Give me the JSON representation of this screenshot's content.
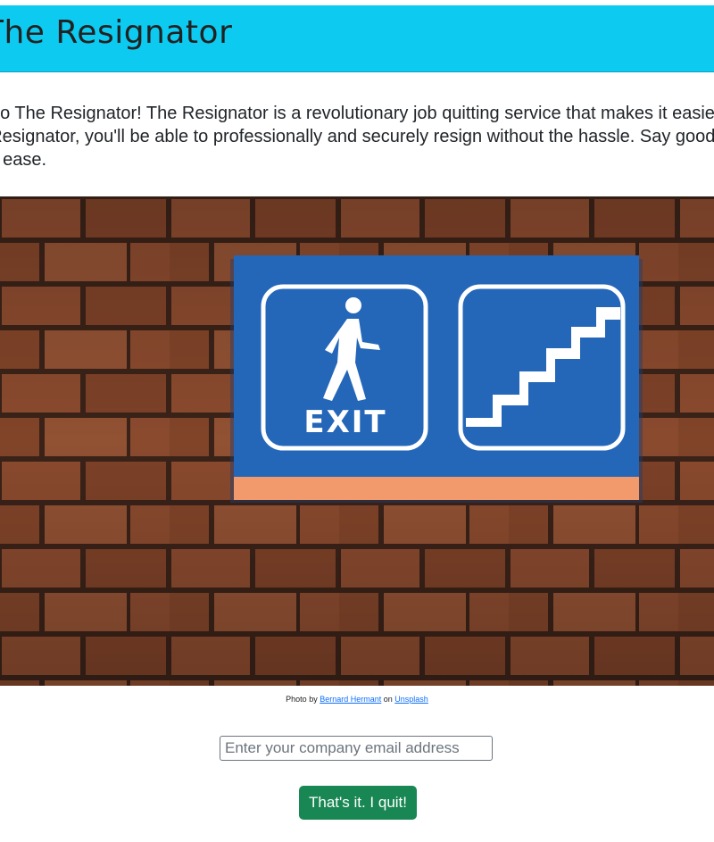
{
  "header": {
    "title": "The Resignator"
  },
  "intro": {
    "line1": "Welcome to The Resignator! The Resignator is a revolutionary job quitting service that makes it easier than ever to quit your job.",
    "line2": "With The Resignator, you'll be able to professionally and securely resign without the hassle. Say goodbye to your job",
    "line3": "with ease."
  },
  "photo": {
    "sign_text": "EXIT",
    "colors": {
      "brick": "#8a4a2e",
      "mortar": "#3a2218",
      "sign": "#2466b8",
      "sign_stripe": "#f39a6c"
    }
  },
  "credit": {
    "prefix": "Photo by",
    "author": "Bernard Hermant",
    "middle": "on",
    "site": "Unsplash"
  },
  "form": {
    "email_placeholder": "Enter your company email address",
    "email_value": "",
    "quit_label": "That's it. I quit!"
  },
  "colors": {
    "header_bg": "#0dcaf0",
    "button_bg": "#198754",
    "link": "#0d6efd"
  }
}
